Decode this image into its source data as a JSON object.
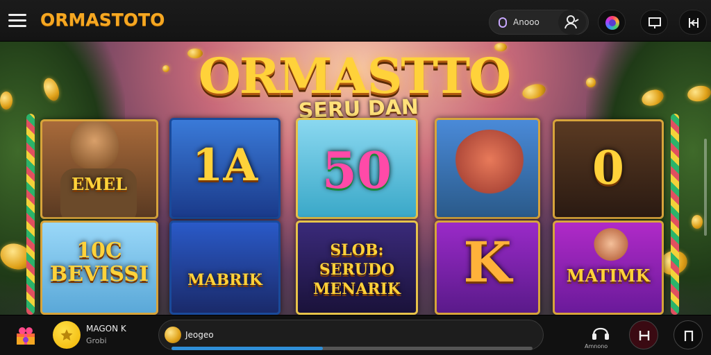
{
  "header": {
    "logo": "ORMASTOTO",
    "search_label": "Anooo",
    "icons": [
      "menu-icon",
      "search-icon",
      "user-icon",
      "color-orb-icon",
      "screen-icon",
      "close-icon"
    ]
  },
  "hero": {
    "title": "ORMASTTO",
    "subtitle": "SERU DAN MENARIK",
    "tiles": [
      {
        "text": "EMEL"
      },
      {
        "text": "1A"
      },
      {
        "text": "50"
      },
      {
        "text": ""
      },
      {
        "text": "0"
      },
      {
        "text": "10C BEVISSI"
      },
      {
        "text": "MABRIK"
      },
      {
        "text": "SLOB: SERUDO MENARIK"
      },
      {
        "text": "K"
      },
      {
        "text": "MATIMK"
      }
    ]
  },
  "footer": {
    "name": "MAGON K",
    "sub": "Grobi",
    "progress_label": "Jeogeo",
    "progress": 0.42,
    "hint_label": "Amnono"
  },
  "colors": {
    "accent": "#f5a722",
    "progress": "#2f8fd8"
  }
}
